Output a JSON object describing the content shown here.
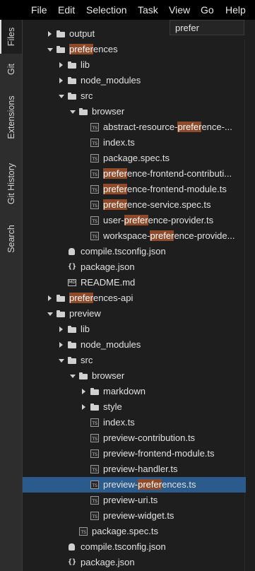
{
  "menu": [
    "File",
    "Edit",
    "Selection",
    "Task",
    "View",
    "Go",
    "Help"
  ],
  "side_tabs": [
    {
      "label": "Files",
      "active": true
    },
    {
      "label": "Git",
      "active": false
    },
    {
      "label": "Extensions",
      "active": false
    },
    {
      "label": "Git History",
      "active": false
    },
    {
      "label": "Search",
      "active": false
    }
  ],
  "filter": {
    "value": "prefer"
  },
  "tree": [
    {
      "level": 1,
      "type": "folder",
      "expanded": false,
      "parts": [
        "output"
      ]
    },
    {
      "level": 1,
      "type": "folder",
      "expanded": true,
      "parts": [
        "",
        "prefer",
        "ences"
      ]
    },
    {
      "level": 2,
      "type": "folder",
      "expanded": false,
      "parts": [
        "lib"
      ]
    },
    {
      "level": 2,
      "type": "folder",
      "expanded": false,
      "parts": [
        "node_modules"
      ]
    },
    {
      "level": 2,
      "type": "folder",
      "expanded": true,
      "parts": [
        "src"
      ]
    },
    {
      "level": 3,
      "type": "folder",
      "expanded": true,
      "parts": [
        "browser"
      ]
    },
    {
      "level": 4,
      "type": "ts",
      "parts": [
        "abstract-resource-",
        "prefer",
        "ence-..."
      ]
    },
    {
      "level": 4,
      "type": "ts",
      "parts": [
        "index.ts"
      ]
    },
    {
      "level": 4,
      "type": "ts",
      "parts": [
        "package.spec.ts"
      ]
    },
    {
      "level": 4,
      "type": "ts",
      "parts": [
        "",
        "prefer",
        "ence-frontend-contributi..."
      ]
    },
    {
      "level": 4,
      "type": "ts",
      "parts": [
        "",
        "prefer",
        "ence-frontend-module.ts"
      ]
    },
    {
      "level": 4,
      "type": "ts",
      "parts": [
        "",
        "prefer",
        "ence-service.spec.ts"
      ]
    },
    {
      "level": 4,
      "type": "ts",
      "parts": [
        "user-",
        "prefer",
        "ence-provider.ts"
      ]
    },
    {
      "level": 4,
      "type": "ts",
      "parts": [
        "workspace-",
        "prefer",
        "ence-provide..."
      ]
    },
    {
      "level": 2,
      "type": "tsconfig",
      "parts": [
        "compile.tsconfig.json"
      ]
    },
    {
      "level": 2,
      "type": "json",
      "parts": [
        "package.json"
      ]
    },
    {
      "level": 2,
      "type": "md",
      "parts": [
        "README.md"
      ]
    },
    {
      "level": 1,
      "type": "folder",
      "expanded": false,
      "parts": [
        "",
        "prefer",
        "ences-api"
      ]
    },
    {
      "level": 1,
      "type": "folder",
      "expanded": true,
      "parts": [
        "preview"
      ]
    },
    {
      "level": 2,
      "type": "folder",
      "expanded": false,
      "parts": [
        "lib"
      ]
    },
    {
      "level": 2,
      "type": "folder",
      "expanded": false,
      "parts": [
        "node_modules"
      ]
    },
    {
      "level": 2,
      "type": "folder",
      "expanded": true,
      "parts": [
        "src"
      ]
    },
    {
      "level": 3,
      "type": "folder",
      "expanded": true,
      "parts": [
        "browser"
      ]
    },
    {
      "level": 4,
      "type": "folder",
      "expanded": false,
      "parts": [
        "markdown"
      ]
    },
    {
      "level": 4,
      "type": "folder",
      "expanded": false,
      "parts": [
        "style"
      ]
    },
    {
      "level": 4,
      "type": "ts",
      "parts": [
        "index.ts"
      ]
    },
    {
      "level": 4,
      "type": "ts",
      "parts": [
        "preview-contribution.ts"
      ]
    },
    {
      "level": 4,
      "type": "ts",
      "parts": [
        "preview-frontend-module.ts"
      ]
    },
    {
      "level": 4,
      "type": "ts",
      "parts": [
        "preview-handler.ts"
      ]
    },
    {
      "level": 4,
      "type": "ts",
      "selected": true,
      "parts": [
        "preview-",
        "prefer",
        "ences.ts"
      ]
    },
    {
      "level": 4,
      "type": "ts",
      "parts": [
        "preview-uri.ts"
      ]
    },
    {
      "level": 4,
      "type": "ts",
      "parts": [
        "preview-widget.ts"
      ]
    },
    {
      "level": 3,
      "type": "ts",
      "parts": [
        "package.spec.ts"
      ]
    },
    {
      "level": 2,
      "type": "tsconfig",
      "parts": [
        "compile.tsconfig.json"
      ]
    },
    {
      "level": 2,
      "type": "json",
      "parts": [
        "package.json"
      ]
    }
  ],
  "icon_glyphs": {
    "ts": "TS",
    "json": "{}",
    "md": "MD"
  },
  "colors": {
    "highlight": "#8f4a29",
    "selected_row": "#2a5b8c",
    "menubar": "#000000",
    "background": "#1e1e1e"
  }
}
